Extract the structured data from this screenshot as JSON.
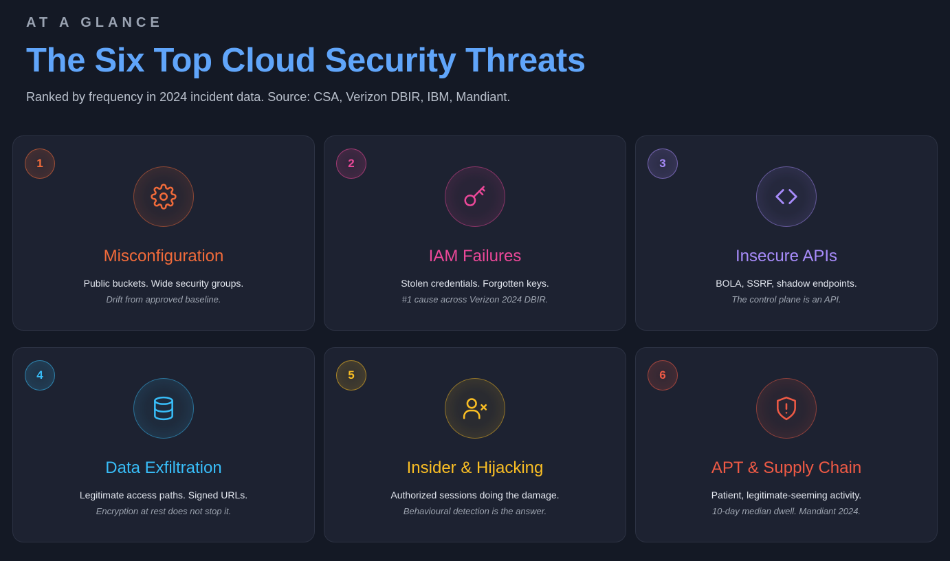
{
  "header": {
    "eyebrow": "AT A GLANCE",
    "title": "The Six Top Cloud Security Threats",
    "subtitle": "Ranked by frequency in 2024 incident data. Source: CSA, Verizon DBIR, IBM, Mandiant."
  },
  "cards": [
    {
      "rank": "1",
      "icon": "gear-icon",
      "title": "Misconfiguration",
      "desc": "Public buckets. Wide security groups.",
      "note": "Drift from approved baseline.",
      "color": "#f26b3a"
    },
    {
      "rank": "2",
      "icon": "key-icon",
      "title": "IAM Failures",
      "desc": "Stolen credentials. Forgotten keys.",
      "note": "#1 cause across Verizon 2024 DBIR.",
      "color": "#ec4899"
    },
    {
      "rank": "3",
      "icon": "code-icon",
      "title": "Insecure APIs",
      "desc": "BOLA, SSRF, shadow endpoints.",
      "note": "The control plane is an API.",
      "color": "#a78bfa"
    },
    {
      "rank": "4",
      "icon": "database-icon",
      "title": "Data Exfiltration",
      "desc": "Legitimate access paths. Signed URLs.",
      "note": "Encryption at rest does not stop it.",
      "color": "#38bdf8"
    },
    {
      "rank": "5",
      "icon": "user-x-icon",
      "title": "Insider & Hijacking",
      "desc": "Authorized sessions doing the damage.",
      "note": "Behavioural detection is the answer.",
      "color": "#fbbf24"
    },
    {
      "rank": "6",
      "icon": "shield-alert-icon",
      "title": "APT & Supply Chain",
      "desc": "Patient, legitimate-seeming activity.",
      "note": "10-day median dwell. Mandiant 2024.",
      "color": "#ef5a45"
    }
  ]
}
